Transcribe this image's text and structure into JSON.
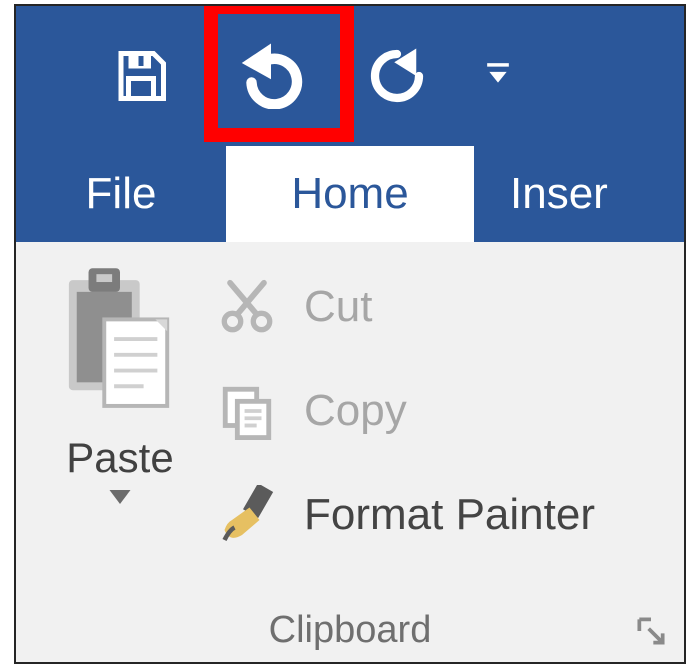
{
  "qat": {
    "save": "Save",
    "undo": "Undo",
    "redo": "Redo",
    "customize": "Customize Quick Access Toolbar"
  },
  "highlight": {
    "target": "undo-button"
  },
  "tabs": {
    "file": "File",
    "home": "Home",
    "insert": "Inser",
    "active": "home"
  },
  "ribbon": {
    "clipboard": {
      "paste": "Paste",
      "cut": "Cut",
      "copy": "Copy",
      "format_painter": "Format Painter",
      "group_label": "Clipboard",
      "dialog_launcher": "Clipboard options"
    }
  },
  "colors": {
    "brand": "#2b579a",
    "ribbon_bg": "#f1f1f1",
    "disabled_text": "#a6a6a6",
    "text": "#444444",
    "highlight": "#ff0000"
  }
}
